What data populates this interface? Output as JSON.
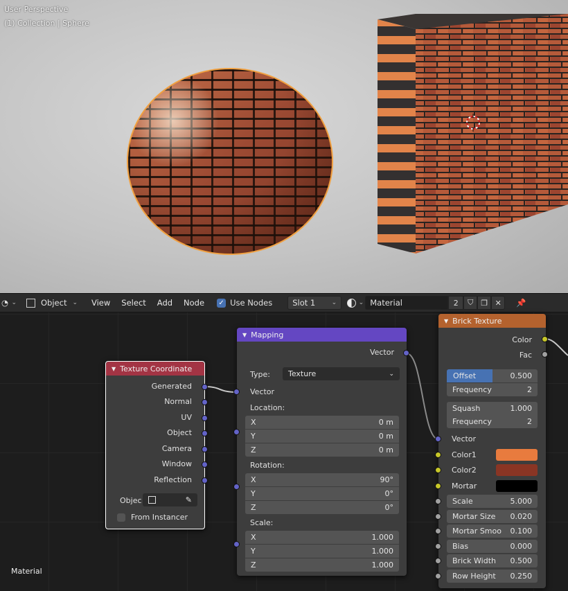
{
  "viewport": {
    "view_name": "User Perspective",
    "collection_label": "(1) Collection | Sphere"
  },
  "header": {
    "mode_label": "Object",
    "menu": [
      "View",
      "Select",
      "Add",
      "Node"
    ],
    "use_nodes_label": "Use Nodes",
    "use_nodes_checked": true,
    "slot_label": "Slot 1",
    "material_name": "Material",
    "user_count": "2"
  },
  "texture_coordinate": {
    "title": "Texture Coordinate",
    "color": "#a33444",
    "outputs": [
      "Generated",
      "Normal",
      "UV",
      "Object",
      "Camera",
      "Window",
      "Reflection"
    ],
    "object_label": "Objec",
    "from_instancer_label": "From Instancer"
  },
  "mapping": {
    "title": "Mapping",
    "color": "#6447c2",
    "output": "Vector",
    "type_label": "Type:",
    "type_value": "Texture",
    "vector_input": "Vector",
    "location_label": "Location:",
    "location": [
      {
        "axis": "X",
        "value": "0 m"
      },
      {
        "axis": "Y",
        "value": "0 m"
      },
      {
        "axis": "Z",
        "value": "0 m"
      }
    ],
    "rotation_label": "Rotation:",
    "rotation": [
      {
        "axis": "X",
        "value": "90°"
      },
      {
        "axis": "Y",
        "value": "0°"
      },
      {
        "axis": "Z",
        "value": "0°"
      }
    ],
    "scale_label": "Scale:",
    "scale": [
      {
        "axis": "X",
        "value": "1.000"
      },
      {
        "axis": "Y",
        "value": "1.000"
      },
      {
        "axis": "Z",
        "value": "1.000"
      }
    ]
  },
  "brick": {
    "title": "Brick Texture",
    "color": "#b4622e",
    "outputs": [
      "Color",
      "Fac"
    ],
    "offset_label": "Offset",
    "offset_value": "0.500",
    "frequency1_label": "Frequency",
    "frequency1_value": "2",
    "squash_label": "Squash",
    "squash_value": "1.000",
    "frequency2_label": "Frequency",
    "frequency2_value": "2",
    "vector_input": "Vector",
    "color1_label": "Color1",
    "color1": "#e87b3e",
    "color2_label": "Color2",
    "color2": "#8a3524",
    "mortar_label": "Mortar",
    "mortar": "#000000",
    "params": [
      {
        "label": "Scale",
        "value": "5.000"
      },
      {
        "label": "Mortar Size",
        "value": "0.020"
      },
      {
        "label": "Mortar Smoo",
        "value": "0.100"
      },
      {
        "label": "Bias",
        "value": "0.000"
      },
      {
        "label": "Brick Width",
        "value": "0.500"
      },
      {
        "label": "Row Height",
        "value": "0.250"
      }
    ]
  },
  "footer": {
    "material_label": "Material"
  }
}
